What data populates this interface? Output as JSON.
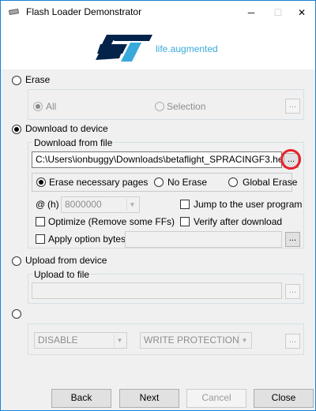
{
  "window": {
    "title": "Flash Loader Demonstrator",
    "minimize_glyph": "─",
    "maximize_glyph": "☐",
    "close_glyph": "✕"
  },
  "logo": {
    "brand_text": "life.augmented",
    "brand_color": "#03234b",
    "accent_color": "#39a9dc"
  },
  "erase": {
    "label": "Erase",
    "all_label": "All",
    "selection_label": "Selection",
    "browse_label": "..."
  },
  "download": {
    "label": "Download to device",
    "group_title": "Download from file",
    "file_path": "C:\\Users\\ionbuggy\\Downloads\\betaflight_SPRACINGF3.hex",
    "browse_label": "...",
    "options": {
      "erase_necessary": "Erase necessary pages",
      "no_erase": "No Erase",
      "global_erase": "Global Erase"
    },
    "at_label": "@",
    "h_label": "(h)",
    "address_value": "8000000",
    "jump_label": "Jump to the user program",
    "optimize_label": "Optimize (Remove some FFs)",
    "verify_label": "Verify after download",
    "apply_bytes_label": "Apply option bytes",
    "apply_browse_label": "..."
  },
  "upload": {
    "label": "Upload from device",
    "group_title": "Upload to file",
    "file_path": "",
    "browse_label": "..."
  },
  "protection": {
    "disable_value": "DISABLE",
    "write_protection_value": "WRITE PROTECTION",
    "browse_label": "..."
  },
  "buttons": {
    "back": "Back",
    "next": "Next",
    "cancel": "Cancel",
    "close": "Close"
  },
  "highlight_color": "#e8202a"
}
